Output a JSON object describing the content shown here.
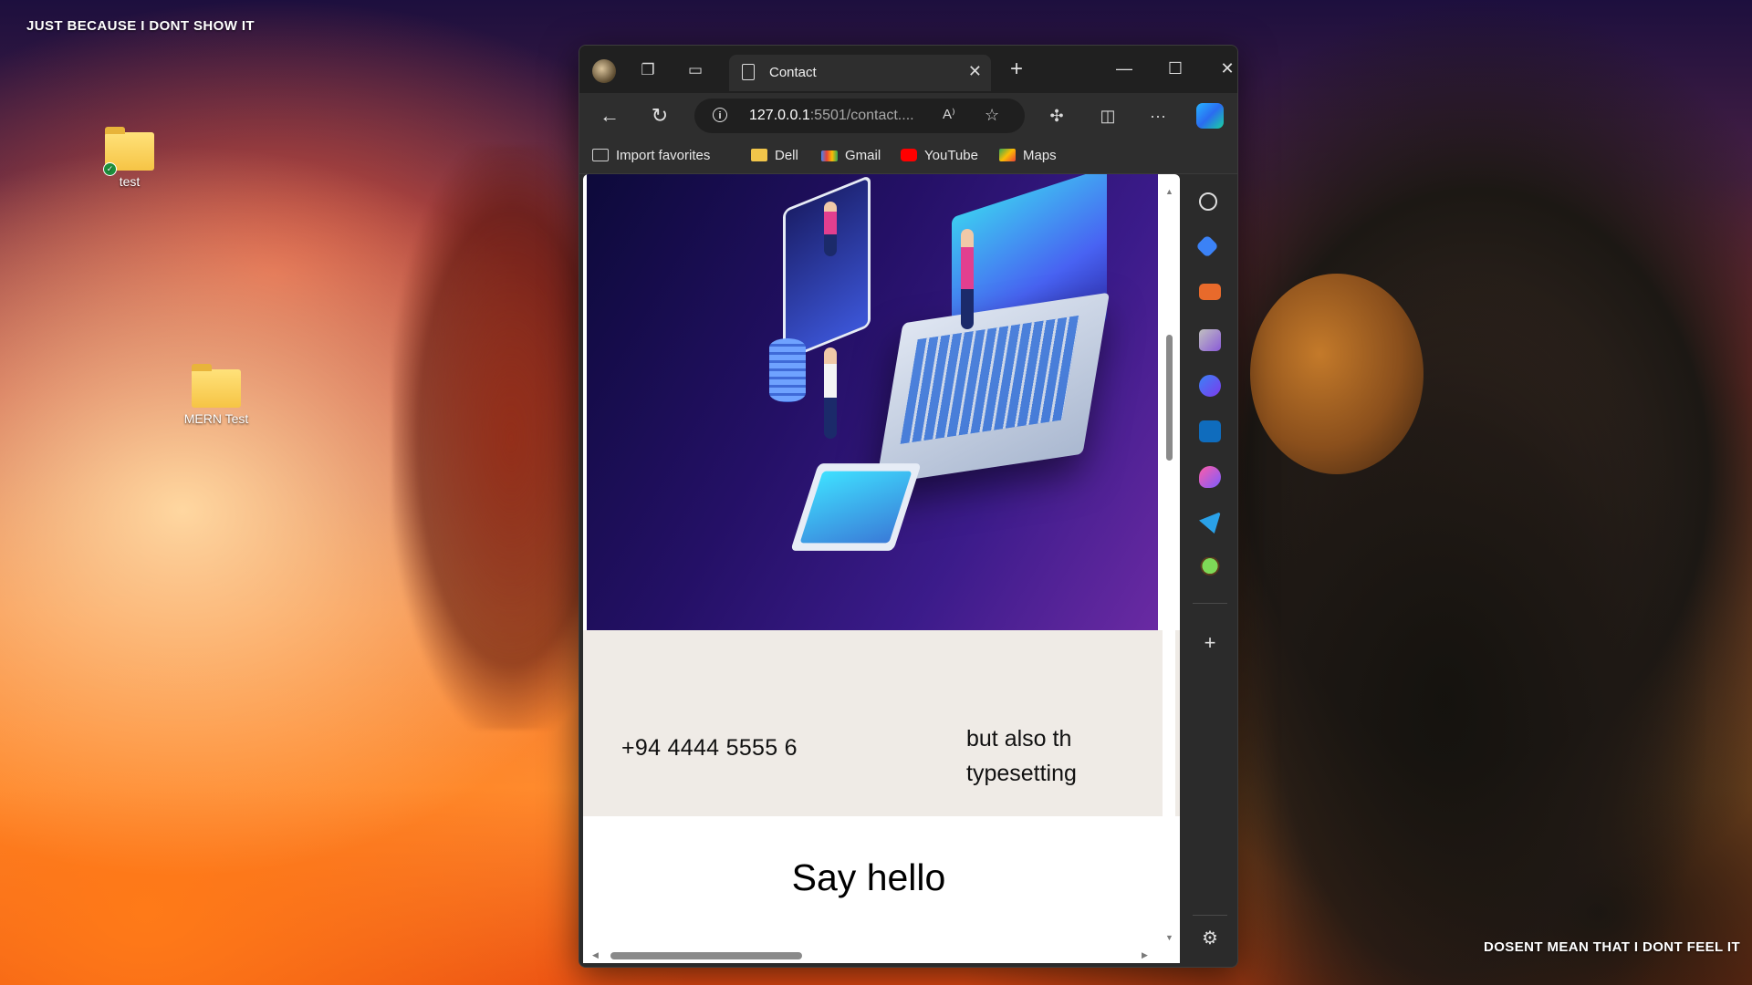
{
  "desktop": {
    "wallpaper_text_top": "JUST BECAUSE I DONT SHOW IT",
    "wallpaper_text_bottom": "DOSENT MEAN THAT I DONT FEEL IT",
    "icons": [
      {
        "label": "test",
        "synced": true
      },
      {
        "label": "MERN Test",
        "synced": false
      }
    ]
  },
  "browser": {
    "tab": {
      "title": "Contact"
    },
    "address": {
      "host": "127.0.0.1",
      "rest": ":5501/contact...."
    },
    "favorites": [
      {
        "label": "Import favorites",
        "icon": "import-favorites-icon"
      },
      {
        "label": "Dell",
        "icon": "folder-icon"
      },
      {
        "label": "Gmail",
        "icon": "gmail-icon"
      },
      {
        "label": "YouTube",
        "icon": "youtube-icon"
      },
      {
        "label": "Maps",
        "icon": "maps-icon"
      }
    ],
    "colors": {
      "frame": "#202020",
      "toolbar": "#2e2e2e",
      "accent": "#2a6cf0"
    }
  },
  "page": {
    "phone": "+94 4444 5555 6",
    "side_text_line1": "but also th",
    "side_text_line2": "typesetting",
    "heading": "Say hello",
    "background_band": "#efebe6"
  },
  "sidebar_icons": [
    "search-icon",
    "shopping-tag-icon",
    "toolbox-icon",
    "games-icon",
    "copilot-icon",
    "outlook-icon",
    "designer-icon",
    "telegram-icon",
    "tree-icon",
    "add-icon",
    "settings-icon"
  ]
}
